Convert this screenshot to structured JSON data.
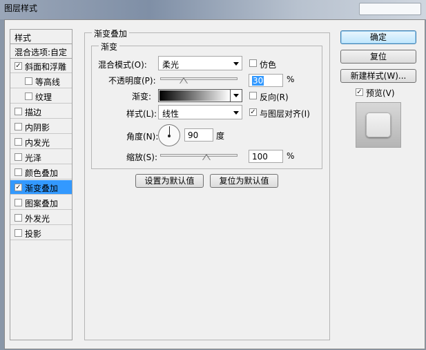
{
  "window": {
    "title": "图层样式"
  },
  "style_list": {
    "header": "样式",
    "blend_options": "混合选项:自定",
    "items": [
      {
        "label": "斜面和浮雕",
        "checked": true,
        "indent": false,
        "selected": false
      },
      {
        "label": "等高线",
        "checked": false,
        "indent": true,
        "selected": false
      },
      {
        "label": "纹理",
        "checked": false,
        "indent": true,
        "selected": false
      },
      {
        "label": "描边",
        "checked": false,
        "indent": false,
        "selected": false
      },
      {
        "label": "内阴影",
        "checked": false,
        "indent": false,
        "selected": false
      },
      {
        "label": "内发光",
        "checked": false,
        "indent": false,
        "selected": false
      },
      {
        "label": "光泽",
        "checked": false,
        "indent": false,
        "selected": false
      },
      {
        "label": "颜色叠加",
        "checked": false,
        "indent": false,
        "selected": false
      },
      {
        "label": "渐变叠加",
        "checked": true,
        "indent": false,
        "selected": true
      },
      {
        "label": "图案叠加",
        "checked": false,
        "indent": false,
        "selected": false
      },
      {
        "label": "外发光",
        "checked": false,
        "indent": false,
        "selected": false
      },
      {
        "label": "投影",
        "checked": false,
        "indent": false,
        "selected": false
      }
    ]
  },
  "panel": {
    "group_title": "渐变叠加",
    "sub_group_title": "渐变",
    "blend_mode_label": "混合模式(O):",
    "blend_mode_value": "柔光",
    "dither_label": "仿色",
    "dither_checked": false,
    "opacity_label": "不透明度(P):",
    "opacity_value": "30",
    "opacity_unit": "%",
    "opacity_fraction": 0.3,
    "gradient_label": "渐变:",
    "reverse_label": "反向(R)",
    "reverse_checked": false,
    "style_label": "样式(L):",
    "style_value": "线性",
    "align_label": "与图层对齐(I)",
    "align_checked": true,
    "angle_label": "角度(N):",
    "angle_value": "90",
    "angle_unit": "度",
    "scale_label": "缩放(S):",
    "scale_value": "100",
    "scale_unit": "%",
    "scale_fraction": 0.6,
    "set_default_button": "设置为默认值",
    "reset_default_button": "复位为默认值"
  },
  "actions": {
    "ok": "确定",
    "reset": "复位",
    "new_style": "新建样式(W)...",
    "preview_label": "预览(V)",
    "preview_checked": true
  },
  "colors": {
    "selection": "#3399ff",
    "dialog_bg": "#f0f0f0",
    "gradient_start": "#000000",
    "gradient_end": "#ffffff"
  },
  "icons": {
    "checkmark": "checkmark-icon",
    "dropdown": "chevron-down-icon",
    "angle": "angle-dial-icon"
  }
}
